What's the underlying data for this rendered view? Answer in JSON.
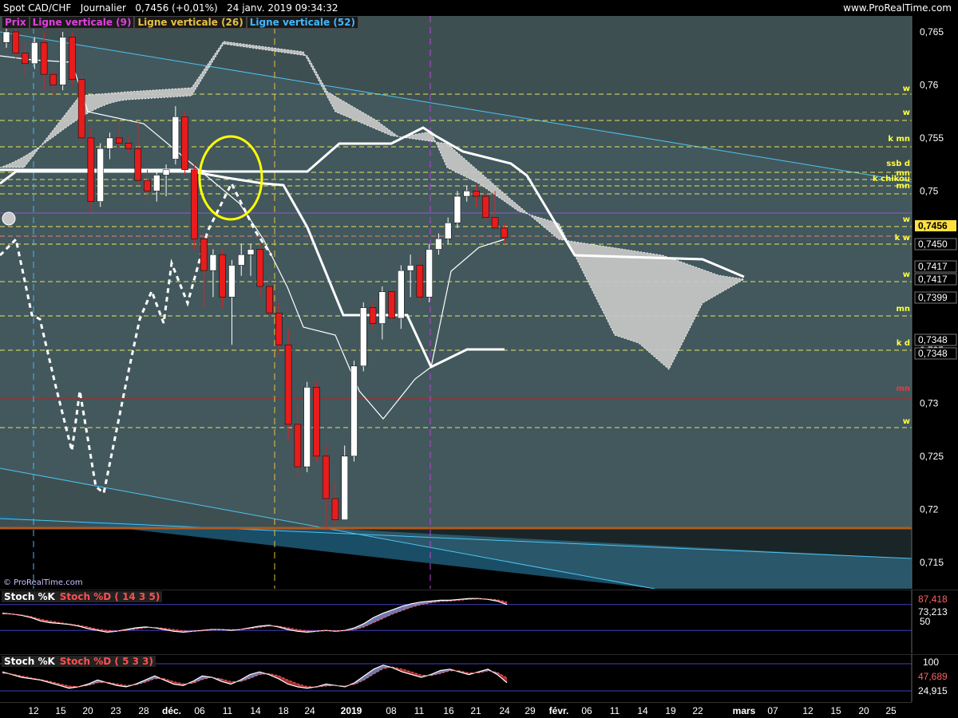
{
  "header": {
    "instrument": "Spot CAD/CHF",
    "period": "Journalier",
    "quote": "0,7456 (+0,01%)",
    "timestamp": "24 janv. 2019 09:34:32",
    "site": "www.ProRealTime.com"
  },
  "legend": [
    {
      "label": "Prix",
      "color": "#e040e0"
    },
    {
      "label": "Ligne verticale (9)",
      "color": "#e040e0"
    },
    {
      "label": "Ligne verticale (26)",
      "color": "#e8c040"
    },
    {
      "label": "Ligne verticale (52)",
      "color": "#40b8ff"
    }
  ],
  "watermark": "© ProRealTime.com",
  "colors": {
    "background": "#3e4f52",
    "bull": "#ffffff",
    "bear": "#e81c1c",
    "cloud": "#c8c8c8",
    "level_line": "#e6e65a",
    "channel": "#4cc4f0"
  },
  "chart_data": [
    {
      "type": "candlestick",
      "y_ticks": [
        "0,765",
        "0,76",
        "0,755",
        "0,75",
        "0,745",
        "0,74",
        "0,735",
        "0,73",
        "0,725",
        "0,72",
        "0,715"
      ],
      "ylim": [
        0.7125,
        0.7665
      ],
      "x_ticks": [
        "12",
        "15",
        "20",
        "23",
        "28",
        "déc.",
        "06",
        "11",
        "14",
        "18",
        "24",
        "2019",
        "08",
        "11",
        "16",
        "21",
        "24",
        "29",
        "févr.",
        "06",
        "11",
        "14",
        "19",
        "22",
        "mars",
        "07",
        "12",
        "15",
        "20",
        "25"
      ],
      "candles": [
        [
          0.764,
          0.7655,
          0.7635,
          0.765
        ],
        [
          0.765,
          0.766,
          0.7625,
          0.763
        ],
        [
          0.763,
          0.764,
          0.761,
          0.762
        ],
        [
          0.762,
          0.7645,
          0.7615,
          0.764
        ],
        [
          0.764,
          0.765,
          0.7595,
          0.761
        ],
        [
          0.761,
          0.7615,
          0.759,
          0.76
        ],
        [
          0.76,
          0.765,
          0.7595,
          0.7645
        ],
        [
          0.7645,
          0.765,
          0.76,
          0.7605
        ],
        [
          0.7605,
          0.761,
          0.7545,
          0.755
        ],
        [
          0.755,
          0.756,
          0.748,
          0.749
        ],
        [
          0.749,
          0.7545,
          0.7485,
          0.754
        ],
        [
          0.754,
          0.7555,
          0.753,
          0.755
        ],
        [
          0.755,
          0.7565,
          0.754,
          0.7545
        ],
        [
          0.7545,
          0.755,
          0.7535,
          0.754
        ],
        [
          0.754,
          0.7565,
          0.7505,
          0.751
        ],
        [
          0.751,
          0.752,
          0.749,
          0.75
        ],
        [
          0.75,
          0.752,
          0.749,
          0.7515
        ],
        [
          0.7515,
          0.7525,
          0.7495,
          0.752
        ],
        [
          0.753,
          0.758,
          0.7525,
          0.757
        ],
        [
          0.757,
          0.7575,
          0.7515,
          0.752
        ],
        [
          0.752,
          0.7525,
          0.7445,
          0.7455
        ],
        [
          0.7455,
          0.746,
          0.739,
          0.7425
        ],
        [
          0.7425,
          0.7445,
          0.74,
          0.744
        ],
        [
          0.744,
          0.7445,
          0.739,
          0.74
        ],
        [
          0.74,
          0.7435,
          0.7355,
          0.743
        ],
        [
          0.743,
          0.745,
          0.742,
          0.744
        ],
        [
          0.744,
          0.745,
          0.742,
          0.7445
        ],
        [
          0.7445,
          0.745,
          0.74,
          0.741
        ],
        [
          0.741,
          0.742,
          0.738,
          0.7385
        ],
        [
          0.7385,
          0.7395,
          0.7345,
          0.7355
        ],
        [
          0.7355,
          0.737,
          0.7265,
          0.728
        ],
        [
          0.728,
          0.73,
          0.723,
          0.724
        ],
        [
          0.724,
          0.732,
          0.7235,
          0.7315
        ],
        [
          0.7315,
          0.732,
          0.7245,
          0.725
        ],
        [
          0.725,
          0.726,
          0.718,
          0.721
        ],
        [
          0.721,
          0.7225,
          0.7185,
          0.719
        ],
        [
          0.719,
          0.726,
          0.7195,
          0.725
        ],
        [
          0.725,
          0.734,
          0.7245,
          0.7335
        ],
        [
          0.7335,
          0.7395,
          0.733,
          0.739
        ],
        [
          0.739,
          0.7395,
          0.737,
          0.7375
        ],
        [
          0.7375,
          0.741,
          0.736,
          0.7405
        ],
        [
          0.7405,
          0.741,
          0.7375,
          0.738
        ],
        [
          0.738,
          0.743,
          0.737,
          0.7425
        ],
        [
          0.7425,
          0.744,
          0.74,
          0.743
        ],
        [
          0.743,
          0.744,
          0.7395,
          0.74
        ],
        [
          0.74,
          0.745,
          0.7395,
          0.7445
        ],
        [
          0.7445,
          0.746,
          0.744,
          0.7455
        ],
        [
          0.7455,
          0.7475,
          0.745,
          0.747
        ],
        [
          0.747,
          0.75,
          0.7465,
          0.7495
        ],
        [
          0.7495,
          0.7505,
          0.749,
          0.75
        ],
        [
          0.75,
          0.7505,
          0.7485,
          0.7495
        ],
        [
          0.7495,
          0.75,
          0.747,
          0.7475
        ],
        [
          0.7475,
          0.75,
          0.7465,
          0.7465
        ],
        [
          0.7465,
          0.747,
          0.745,
          0.7456
        ]
      ],
      "price_labels": [
        "0,7456",
        "0,7450",
        "0,7417",
        "0,7417",
        "0,7399",
        "0,7348",
        "0,7348"
      ],
      "level_markers": [
        "w",
        "w",
        "k mn",
        "ssb d",
        "mn",
        "k chikou",
        "mn",
        "w",
        "k w",
        "w",
        "mn",
        "k d",
        "mn",
        "w"
      ]
    },
    {
      "type": "line",
      "name": "Stoch %K / Stoch %D (14 3 5)",
      "labels": [
        "Stoch %K",
        "Stoch %D ( 14 3 5)"
      ],
      "ylim": [
        0,
        100
      ],
      "value_labels": [
        "87,418",
        "73,213",
        "50"
      ],
      "k": [
        60,
        58,
        55,
        50,
        42,
        38,
        36,
        34,
        30,
        24,
        20,
        16,
        18,
        22,
        26,
        28,
        26,
        22,
        18,
        16,
        18,
        20,
        22,
        22,
        20,
        22,
        26,
        30,
        32,
        28,
        22,
        18,
        16,
        18,
        20,
        18,
        20,
        26,
        36,
        50,
        60,
        68,
        76,
        82,
        86,
        88,
        90,
        90,
        92,
        94,
        94,
        92,
        88,
        80
      ],
      "d": [
        58,
        58,
        56,
        52,
        46,
        42,
        38,
        35,
        32,
        28,
        23,
        20,
        18,
        20,
        23,
        26,
        27,
        25,
        22,
        19,
        18,
        19,
        21,
        22,
        22,
        22,
        24,
        27,
        30,
        30,
        26,
        22,
        19,
        18,
        19,
        19,
        19,
        22,
        28,
        38,
        48,
        58,
        66,
        74,
        80,
        84,
        87,
        88,
        90,
        92,
        93,
        93,
        91,
        86
      ]
    },
    {
      "type": "line",
      "name": "Stoch %K / Stoch %D (5 3 3)",
      "labels": [
        "Stoch %K",
        "Stoch %D ( 5 3 3)"
      ],
      "ylim": [
        0,
        100
      ],
      "value_labels": [
        "100",
        "47,689",
        "24,915"
      ],
      "k": [
        70,
        60,
        50,
        45,
        40,
        30,
        20,
        10,
        15,
        25,
        40,
        30,
        20,
        15,
        25,
        40,
        55,
        40,
        25,
        20,
        35,
        55,
        50,
        35,
        25,
        40,
        60,
        70,
        60,
        45,
        25,
        15,
        10,
        15,
        25,
        20,
        15,
        30,
        55,
        80,
        95,
        85,
        70,
        60,
        50,
        60,
        75,
        80,
        70,
        60,
        70,
        80,
        60,
        30
      ],
      "d": [
        65,
        62,
        55,
        48,
        42,
        35,
        26,
        18,
        15,
        20,
        30,
        32,
        26,
        20,
        22,
        32,
        45,
        45,
        34,
        26,
        28,
        42,
        50,
        44,
        34,
        34,
        46,
        60,
        64,
        56,
        40,
        26,
        16,
        14,
        18,
        20,
        18,
        24,
        40,
        62,
        82,
        88,
        80,
        70,
        58,
        56,
        64,
        74,
        74,
        66,
        66,
        74,
        68,
        48
      ]
    }
  ]
}
